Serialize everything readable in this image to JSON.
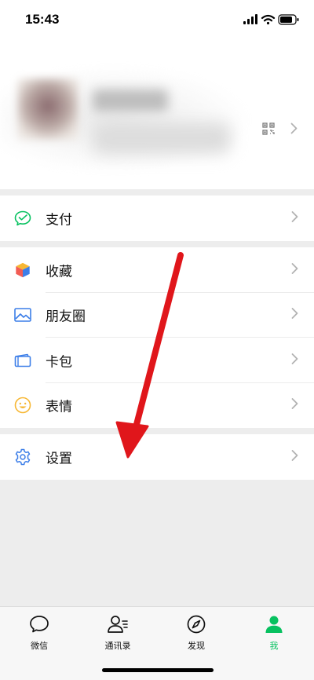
{
  "status_bar": {
    "time": "15:43"
  },
  "menu": {
    "pay": {
      "label": "支付",
      "icon": "wechat-pay-icon"
    },
    "favorites": {
      "label": "收藏",
      "icon": "favorites-cube-icon"
    },
    "moments": {
      "label": "朋友圈",
      "icon": "moments-picture-icon"
    },
    "cards": {
      "label": "卡包",
      "icon": "card-wallet-icon"
    },
    "stickers": {
      "label": "表情",
      "icon": "smiley-icon"
    },
    "settings": {
      "label": "设置",
      "icon": "gear-icon"
    }
  },
  "tabbar": {
    "chats": {
      "label": "微信",
      "icon": "chat-bubble-icon"
    },
    "contacts": {
      "label": "通讯录",
      "icon": "contacts-icon"
    },
    "discover": {
      "label": "发现",
      "icon": "compass-icon"
    },
    "me": {
      "label": "我",
      "icon": "person-icon",
      "active": true
    }
  },
  "colors": {
    "accent_green": "#07c160",
    "annotation_arrow": "#e0161b"
  }
}
